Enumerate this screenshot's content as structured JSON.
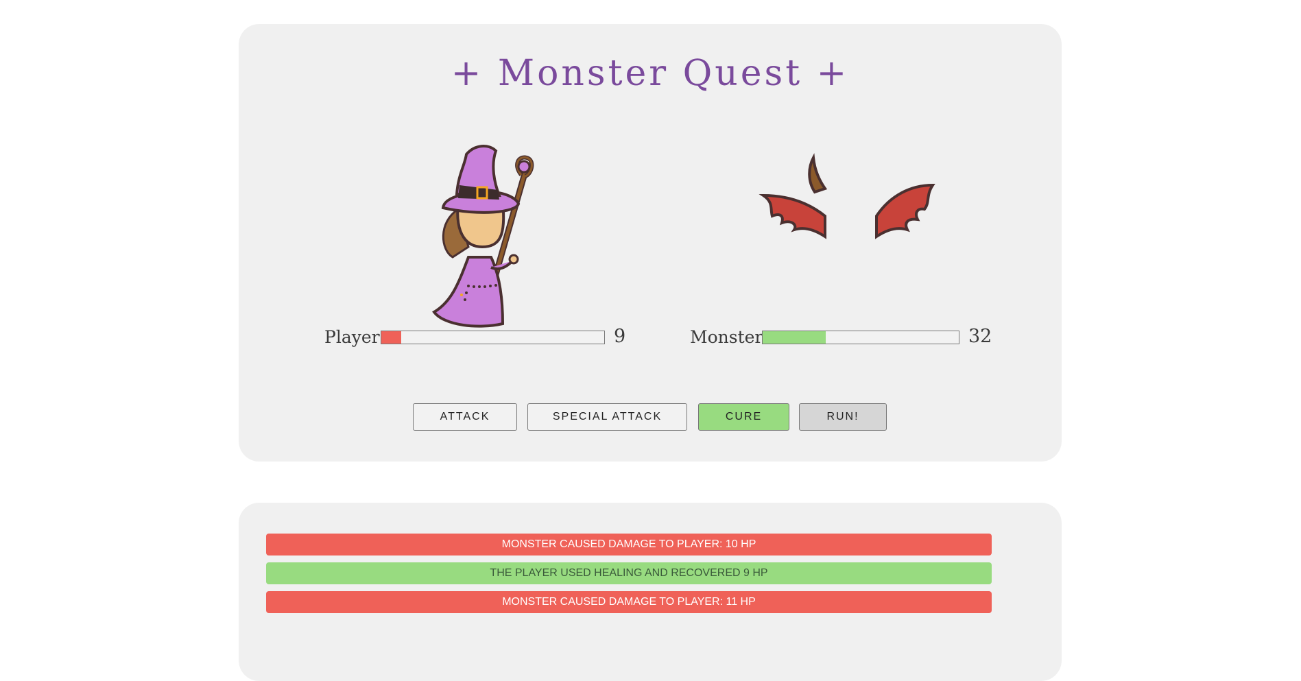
{
  "title": "+ Monster Quest +",
  "player": {
    "label": "Player",
    "hp": 9,
    "max_hp": 100,
    "bar_color": "#ef6158"
  },
  "monster": {
    "label": "Monster",
    "hp": 32,
    "max_hp": 100,
    "bar_color": "#98db80"
  },
  "actions": {
    "attack": "ATTACK",
    "special_attack": "SPECIAL ATTACK",
    "cure": "CURE",
    "run": "RUN!"
  },
  "colors": {
    "title": "#7a4a9c",
    "damage": "#ef6158",
    "heal": "#98db80",
    "cure_button": "#98db80",
    "run_button": "#d6d6d6",
    "panel": "#f0f0f0"
  },
  "log": [
    {
      "type": "damage",
      "text": "MONSTER CAUSED DAMAGE TO PLAYER: 10 HP"
    },
    {
      "type": "heal",
      "text": "THE PLAYER USED HEALING AND RECOVERED 9 HP"
    },
    {
      "type": "damage",
      "text": "MONSTER CAUSED DAMAGE TO PLAYER: 11 HP"
    }
  ]
}
